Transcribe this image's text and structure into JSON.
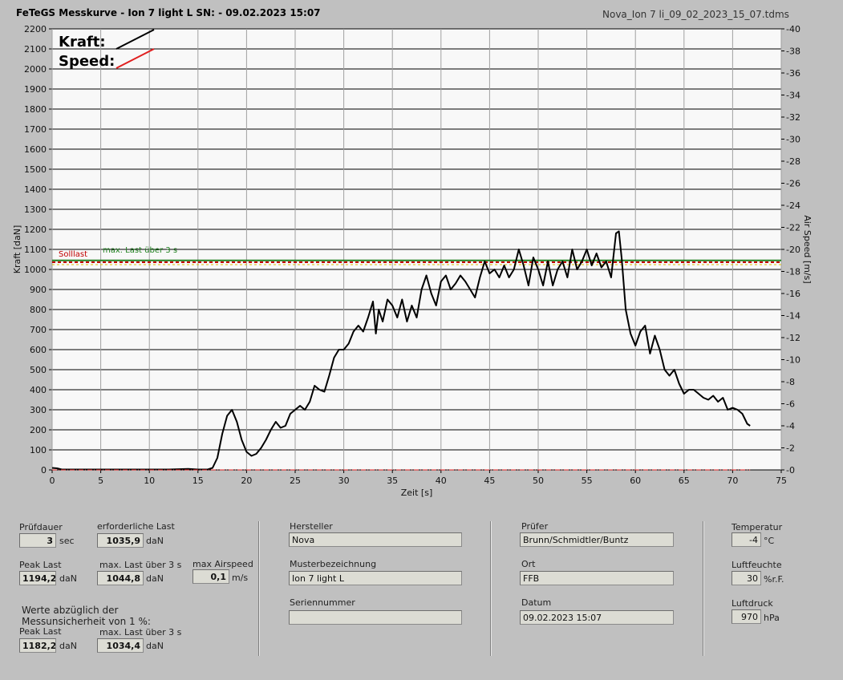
{
  "header": {
    "title": "FeTeGS Messkurve - Ion 7 light L  SN:  - 09.02.2023 15:07",
    "filename": "Nova_Ion 7 li_09_02_2023_15_07.tdms"
  },
  "chart_data": {
    "type": "line",
    "xlabel": "Zeit [s]",
    "ylabel": "Kraft [daN]",
    "y2label": "Air Speed [m/s]",
    "xlim": [
      0,
      75
    ],
    "ylim": [
      0,
      2200
    ],
    "y2lim": [
      0,
      40
    ],
    "xticks": [
      "0",
      "5",
      "10",
      "15",
      "20",
      "25",
      "30",
      "35",
      "40",
      "45",
      "50",
      "55",
      "60",
      "65",
      "70",
      "75"
    ],
    "yticks": [
      "0",
      "100",
      "200",
      "300",
      "400",
      "500",
      "600",
      "700",
      "800",
      "900",
      "1000",
      "1100",
      "1200",
      "1300",
      "1400",
      "1500",
      "1600",
      "1700",
      "1800",
      "1900",
      "2000",
      "2100",
      "2200"
    ],
    "y2ticks": [
      "0",
      "2",
      "4",
      "6",
      "8",
      "10",
      "12",
      "14",
      "16",
      "18",
      "20",
      "22",
      "24",
      "26",
      "28",
      "30",
      "32",
      "34",
      "36",
      "38",
      "40"
    ],
    "grid": "horizontal and vertical",
    "legend": {
      "position": "top-left",
      "kraft_label": "Kraft:",
      "speed_label": "Speed:",
      "kraft_color": "#000000",
      "speed_color": "#e02020"
    },
    "reference_lines": [
      {
        "name": "Solllast",
        "value": 1035.9,
        "color": "#c00000"
      },
      {
        "name": "max. Last über  3 s",
        "value": 1044.8,
        "color": "#208020"
      }
    ],
    "series": [
      {
        "name": "Kraft",
        "color": "#000000",
        "x": [
          0,
          0.5,
          1,
          3,
          6,
          8,
          10,
          12,
          14,
          15,
          16,
          16.5,
          17,
          17.5,
          18,
          18.5,
          19,
          19.5,
          20,
          20.5,
          21,
          21.5,
          22,
          22.5,
          23,
          23.5,
          24,
          24.5,
          25,
          25.5,
          26,
          26.5,
          27,
          27.5,
          28,
          28.5,
          29,
          29.5,
          30,
          30.5,
          31,
          31.5,
          32,
          32.5,
          33,
          33.3,
          33.6,
          34,
          34.5,
          35,
          35.5,
          36,
          36.5,
          37,
          37.5,
          38,
          38.5,
          39,
          39.5,
          40,
          40.5,
          41,
          41.5,
          42,
          42.5,
          43,
          43.5,
          44,
          44.5,
          45,
          45.5,
          46,
          46.5,
          47,
          47.5,
          48,
          48.5,
          49,
          49.5,
          50,
          50.5,
          51,
          51.5,
          52,
          52.5,
          53,
          53.5,
          54,
          54.5,
          55,
          55.5,
          56,
          56.5,
          57,
          57.5,
          58,
          58.3,
          58.6,
          59,
          59.5,
          60,
          60.5,
          61,
          61.5,
          62,
          62.5,
          63,
          63.5,
          64,
          64.5,
          65,
          65.5,
          66,
          66.5,
          67,
          67.5,
          68,
          68.5,
          69,
          69.5,
          70,
          70.5,
          71,
          71.5,
          71.8
        ],
        "values": [
          10,
          8,
          2,
          2,
          2,
          2,
          2,
          2,
          5,
          2,
          2,
          10,
          60,
          180,
          270,
          300,
          240,
          150,
          90,
          70,
          80,
          110,
          150,
          200,
          240,
          210,
          220,
          280,
          300,
          320,
          300,
          340,
          420,
          400,
          390,
          470,
          560,
          600,
          600,
          630,
          690,
          720,
          690,
          760,
          840,
          680,
          800,
          740,
          850,
          820,
          760,
          850,
          740,
          820,
          760,
          900,
          970,
          880,
          820,
          940,
          970,
          900,
          930,
          970,
          940,
          900,
          860,
          960,
          1040,
          980,
          1000,
          960,
          1020,
          960,
          1000,
          1100,
          1020,
          920,
          1060,
          1000,
          920,
          1040,
          920,
          1000,
          1040,
          960,
          1100,
          1000,
          1040,
          1100,
          1020,
          1080,
          1010,
          1040,
          960,
          1180,
          1190,
          1050,
          800,
          680,
          620,
          690,
          720,
          580,
          670,
          600,
          500,
          470,
          500,
          430,
          380,
          400,
          400,
          380,
          360,
          350,
          370,
          340,
          360,
          300,
          310,
          300,
          280,
          230,
          220
        ]
      },
      {
        "name": "Speed",
        "color": "#e02020",
        "x": [
          0,
          71.8
        ],
        "values": [
          0,
          0
        ]
      }
    ]
  },
  "summary": {
    "pruefdauer": {
      "label": "Prüfdauer",
      "value": "3",
      "unit": "sec"
    },
    "erforderliche_last": {
      "label": "erforderliche Last",
      "value": "1035,9",
      "unit": "daN"
    },
    "peak_last": {
      "label": "Peak Last",
      "value": "1194,2",
      "unit": "daN"
    },
    "max_last_3s": {
      "label": "max. Last über  3 s",
      "value": "1044,8",
      "unit": "daN"
    },
    "max_airspeed": {
      "label": "max Airspeed",
      "value": "0,1",
      "unit": "m/s"
    },
    "note_line1": "Werte abzüglich der",
    "note_line2": "Messunsicherheit von 1  %:",
    "peak_last_corr": {
      "label": "Peak Last",
      "value": "1182,2",
      "unit": "daN"
    },
    "max_last_3s_corr": {
      "label": "max. Last über  3 s",
      "value": "1034,4",
      "unit": "daN"
    }
  },
  "info": {
    "hersteller": {
      "label": "Hersteller",
      "value": "Nova"
    },
    "musterbezeichnung": {
      "label": "Musterbezeichnung",
      "value": "Ion 7 light L"
    },
    "seriennummer": {
      "label": "Seriennummer",
      "value": ""
    },
    "pruefer": {
      "label": "Prüfer",
      "value": "Brunn/Schmidtler/Buntz"
    },
    "ort": {
      "label": "Ort",
      "value": "FFB"
    },
    "datum": {
      "label": "Datum",
      "value": "09.02.2023 15:07"
    }
  },
  "environment": {
    "temperatur": {
      "label": "Temperatur",
      "value": "-4",
      "unit": "°C"
    },
    "luftfeuchte": {
      "label": "Luftfeuchte",
      "value": "30",
      "unit": "%r.F."
    },
    "luftdruck": {
      "label": "Luftdruck",
      "value": "970",
      "unit": "hPa"
    }
  }
}
